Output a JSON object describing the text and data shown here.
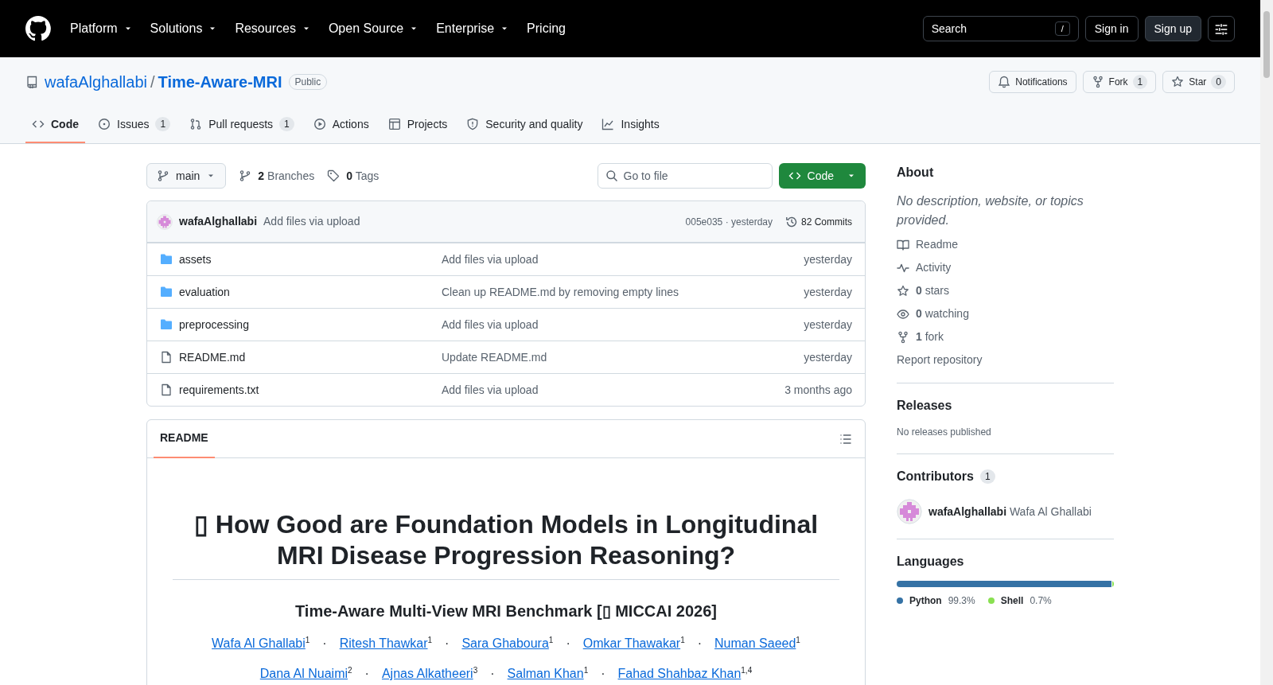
{
  "top_nav": {
    "menus": [
      {
        "label": "Platform",
        "dropdown": true
      },
      {
        "label": "Solutions",
        "dropdown": true
      },
      {
        "label": "Resources",
        "dropdown": true
      },
      {
        "label": "Open Source",
        "dropdown": true
      },
      {
        "label": "Enterprise",
        "dropdown": true
      },
      {
        "label": "Pricing",
        "dropdown": false
      }
    ],
    "search": {
      "placeholder": "Search",
      "shortcut": "/"
    },
    "sign_in": "Sign in",
    "sign_up": "Sign up"
  },
  "repo": {
    "owner": "wafaAlghallabi",
    "separator": "/",
    "name": "Time-Aware-MRI",
    "visibility": "Public",
    "actions": [
      {
        "kind": "bell",
        "label": "Notifications"
      },
      {
        "kind": "fork",
        "label": "Fork",
        "count": "1"
      },
      {
        "kind": "star",
        "label": "Star",
        "count": "0"
      }
    ]
  },
  "tabs": [
    {
      "kind": "code",
      "label": "Code",
      "selected": true
    },
    {
      "kind": "issues",
      "label": "Issues",
      "count": "1",
      "selected": false
    },
    {
      "kind": "pulls",
      "label": "Pull requests",
      "count": "1",
      "selected": false
    },
    {
      "kind": "actions",
      "label": "Actions",
      "selected": false
    },
    {
      "kind": "projects",
      "label": "Projects",
      "selected": false
    },
    {
      "kind": "security",
      "label": "Security and quality",
      "selected": false
    },
    {
      "kind": "insights",
      "label": "Insights",
      "selected": false
    }
  ],
  "toolbar": {
    "branch": "main",
    "branches_count": "2",
    "branches_label": "Branches",
    "tags_count": "0",
    "tags_label": "Tags",
    "file_search": {
      "placeholder": "Go to file"
    },
    "code_button": "Code"
  },
  "latest_commit": {
    "author": "wafaAlghallabi",
    "message": "Add files via upload",
    "hash_time": "005e035 · yesterday",
    "commits": "82 Commits"
  },
  "files": [
    {
      "kind": "folder",
      "name": "assets",
      "message": "Add files via upload",
      "time": "yesterday"
    },
    {
      "kind": "folder",
      "name": "evaluation",
      "message": "Clean up README.md by removing empty lines",
      "time": "yesterday"
    },
    {
      "kind": "folder",
      "name": "preprocessing",
      "message": "Add files via upload",
      "time": "yesterday"
    },
    {
      "kind": "file",
      "name": "README.md",
      "message": "Update README.md",
      "time": "yesterday"
    },
    {
      "kind": "file",
      "name": "requirements.txt",
      "message": "Add files via upload",
      "time": "3 months ago"
    }
  ],
  "readme": {
    "tab": "README",
    "title": "▯ How Good are Foundation Models in Longitudinal MRI Disease Progression Reasoning?",
    "subtitle": "Time-Aware Multi-View MRI Benchmark [▯ MICCAI 2026]",
    "author_lines": [
      [
        {
          "kind": "author",
          "name": "Wafa Al Ghallabi",
          "affiliation": "1"
        },
        {
          "kind": "separator",
          "text": "·"
        },
        {
          "kind": "author",
          "name": "Ritesh Thawkar",
          "affiliation": "1"
        },
        {
          "kind": "separator",
          "text": "·"
        },
        {
          "kind": "author",
          "name": "Sara Ghaboura",
          "affiliation": "1"
        },
        {
          "kind": "separator",
          "text": "·"
        },
        {
          "kind": "author",
          "name": "Omkar Thawakar",
          "affiliation": "1"
        },
        {
          "kind": "separator",
          "text": "·"
        },
        {
          "kind": "author",
          "name": "Numan Saeed",
          "affiliation": "1"
        }
      ],
      [
        {
          "kind": "author",
          "name": "Dana Al Nuaimi",
          "affiliation": "2"
        },
        {
          "kind": "separator",
          "text": "·"
        },
        {
          "kind": "author",
          "name": "Ajnas Alkatheeri",
          "affiliation": "3"
        },
        {
          "kind": "separator",
          "text": "·"
        },
        {
          "kind": "author",
          "name": "Salman Khan",
          "affiliation": "1"
        },
        {
          "kind": "separator",
          "text": "·"
        },
        {
          "kind": "author",
          "name": "Fahad Shahbaz Khan",
          "affiliation": "1,4"
        }
      ]
    ]
  },
  "about": {
    "heading": "About",
    "description": "No description, website, or topics provided.",
    "links": [
      {
        "kind": "book",
        "label": "Readme"
      },
      {
        "kind": "pulse",
        "label": "Activity"
      },
      {
        "kind": "star",
        "count": "0",
        "label": "stars"
      },
      {
        "kind": "eye",
        "count": "0",
        "label": "watching"
      },
      {
        "kind": "fork",
        "count": "1",
        "label": "fork"
      }
    ],
    "report": "Report repository"
  },
  "releases": {
    "heading": "Releases",
    "note": "No releases published"
  },
  "contributors": {
    "heading": "Contributors",
    "count": "1",
    "people": [
      {
        "login": "wafaAlghallabi",
        "name": "Wafa Al Ghallabi"
      }
    ]
  },
  "languages": {
    "heading": "Languages",
    "items": [
      {
        "name": "Python",
        "percent": "99.3%",
        "level": 0.993,
        "color": "#3572a5"
      },
      {
        "name": "Shell",
        "percent": "0.7%",
        "level": 0.007,
        "color": "#89e051"
      }
    ]
  }
}
